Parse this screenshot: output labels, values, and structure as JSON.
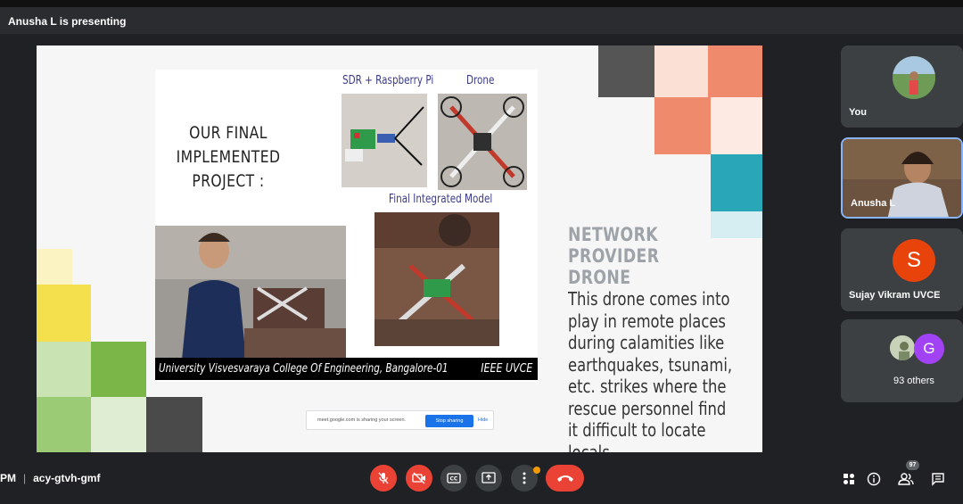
{
  "presenter": {
    "text": "Anusha L is presenting"
  },
  "slide": {
    "title_line1": "OUR FINAL",
    "title_line2": "IMPLEMENTED PROJECT :",
    "caption_sdr": "SDR + Raspberry Pi",
    "caption_drone": "Drone",
    "caption_model": "Final Integrated Model",
    "footer_university": "University Visvesvaraya College Of Engineering, Bangalore-01",
    "footer_ieee": "IEEE UVCE",
    "np_title_line1": "NETWORK PROVIDER",
    "np_title_line2": "DRONE",
    "np_body": "This drone comes into play in remote places during calamities like earthquakes, tsunami, etc. strikes where the rescue personnel find it difficult to locate locals.",
    "colors": {
      "orange": "#f08a6c",
      "teal": "#29a7b8",
      "green": "#7ab648",
      "yellow": "#f4e04d",
      "dark": "#444444"
    }
  },
  "share_notice": {
    "message": "meet.google.com is sharing your screen.",
    "stop_label": "Stop sharing",
    "hide_label": "Hide"
  },
  "participants": [
    {
      "name": "You"
    },
    {
      "name": "Anusha L"
    },
    {
      "name": "Sujay Vikram UVCE",
      "initial": "S",
      "color": "#e8430a"
    },
    {
      "name": "93 others",
      "initial": "G",
      "color": "#a142f4"
    }
  ],
  "meeting": {
    "time_fragment": "PM",
    "code": "acy-gtvh-gmf",
    "people_count": "97"
  }
}
